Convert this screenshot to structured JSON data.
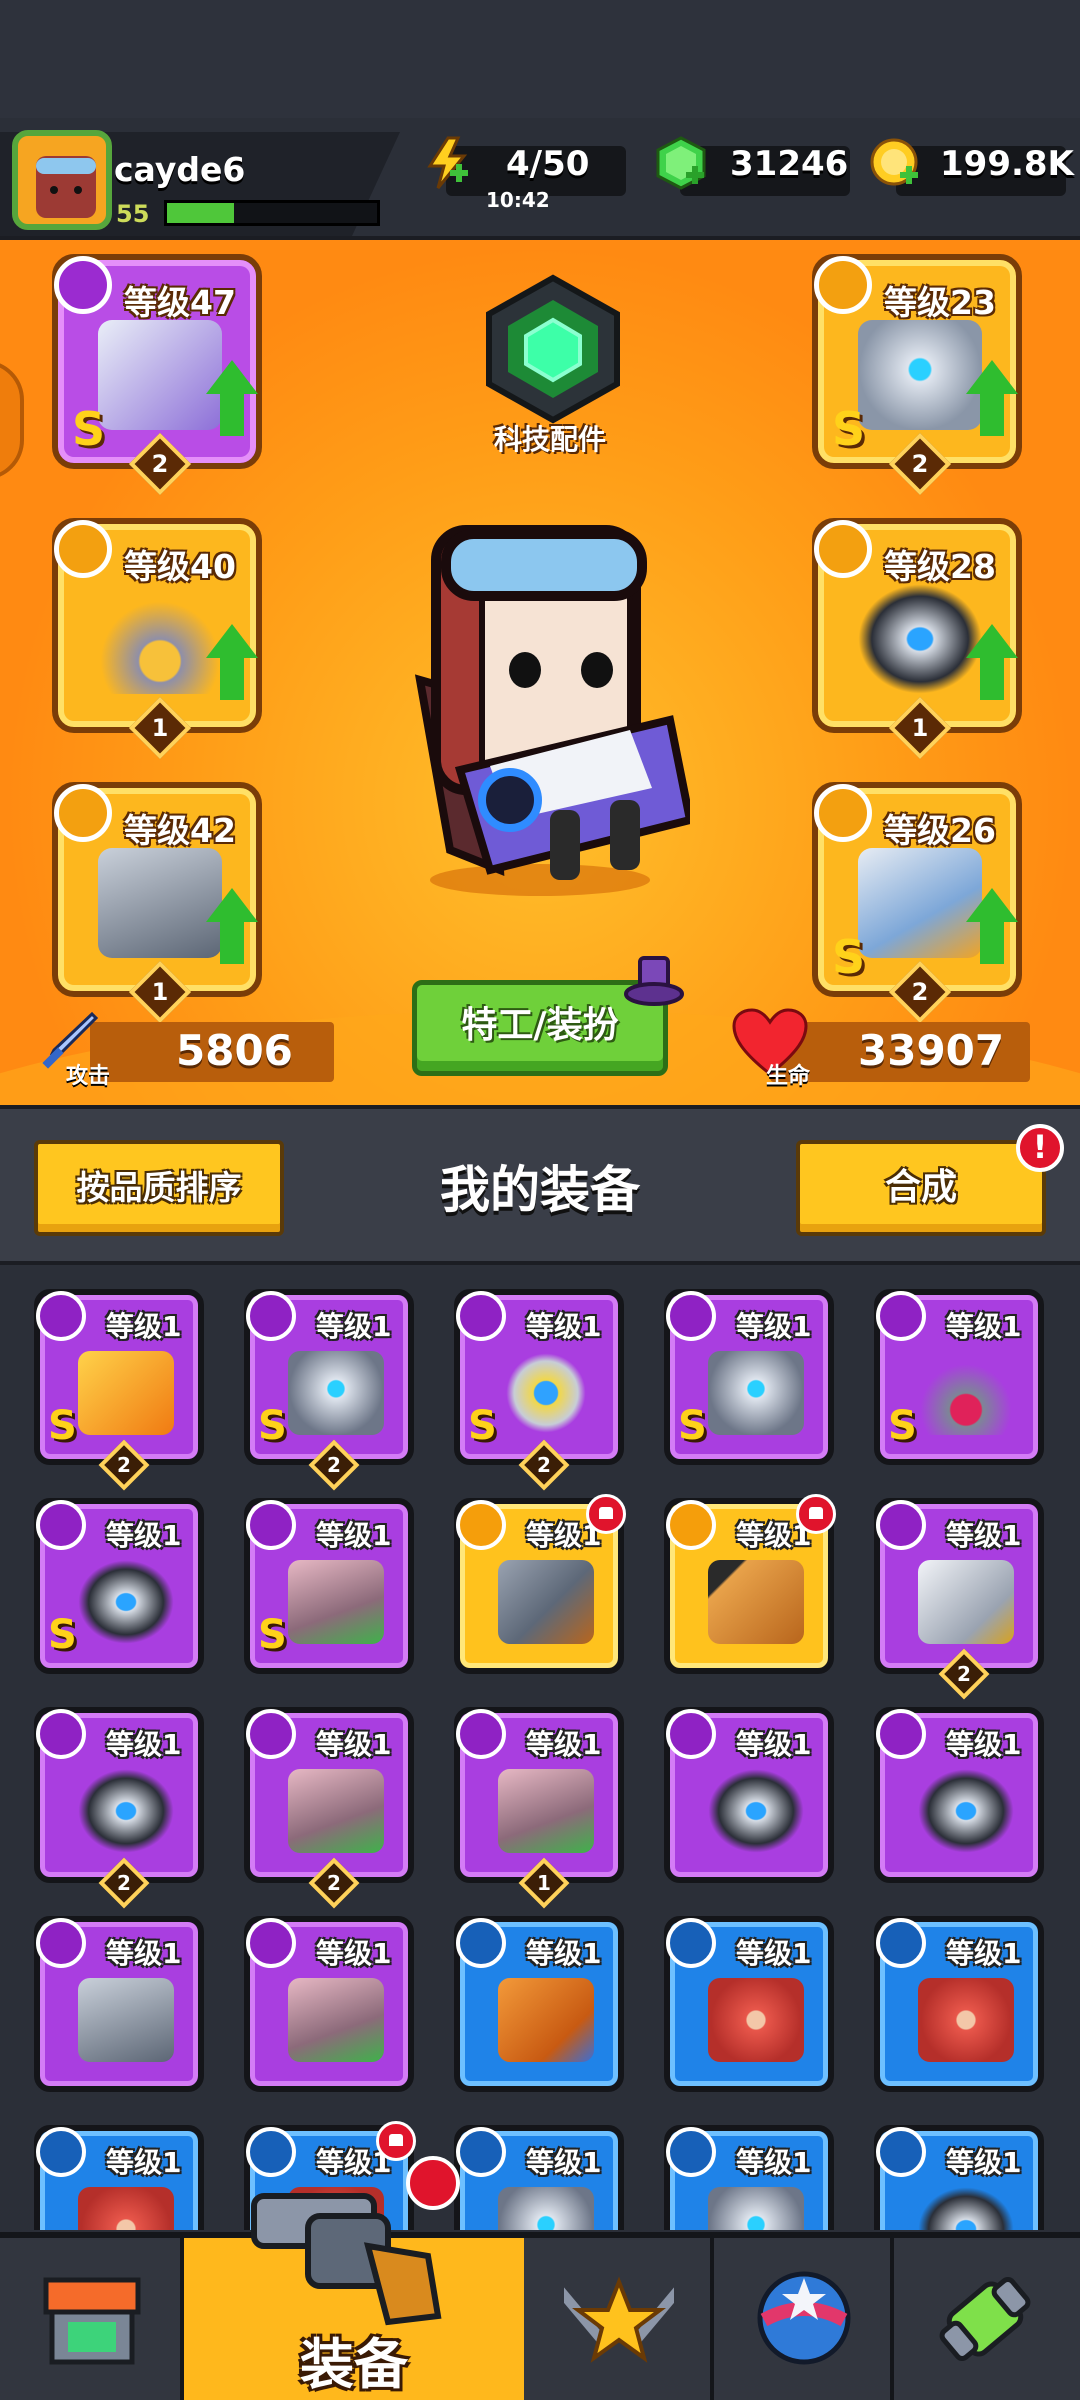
{
  "player": {
    "name": "cayde6",
    "level": "55",
    "xp_fraction": 0.32
  },
  "resources": {
    "energy": {
      "value": "4/50",
      "timer": "10:42",
      "icon": "lightning-icon"
    },
    "gems": {
      "value": "31246",
      "icon": "gem-icon"
    },
    "coins": {
      "value": "199.8K",
      "icon": "coin-icon"
    }
  },
  "slots": {
    "weapon": {
      "level": "等级47",
      "grade": "S",
      "stars": "2",
      "upgrade": true,
      "icon": "gun-icon"
    },
    "necklace": {
      "level": "等级40",
      "grade": "",
      "stars": "1",
      "upgrade": true,
      "icon": "necklace-icon"
    },
    "gloves": {
      "level": "等级42",
      "grade": "",
      "stars": "1",
      "upgrade": true,
      "icon": "glove-icon"
    },
    "armor": {
      "level": "等级23",
      "grade": "S",
      "stars": "2",
      "upgrade": true,
      "icon": "armor-icon"
    },
    "belt": {
      "level": "等级28",
      "grade": "",
      "stars": "1",
      "upgrade": true,
      "icon": "belt-icon"
    },
    "boots": {
      "level": "等级26",
      "grade": "S",
      "stars": "2",
      "upgrade": true,
      "icon": "boot-icon"
    }
  },
  "tech": {
    "label": "科技配件"
  },
  "stats": {
    "attack": {
      "label": "攻击",
      "value": "5806"
    },
    "health": {
      "label": "生命",
      "value": "33907"
    }
  },
  "agent_button": "特工/装扮",
  "inventory_header": {
    "sort": "按品质排序",
    "title": "我的装备",
    "synthesize": "合成",
    "alert": "!"
  },
  "inventory": [
    {
      "level": "等级1",
      "rarity": "purple",
      "grade": "S",
      "stars": "2",
      "icon": "sword-icon",
      "new": false
    },
    {
      "level": "等级1",
      "rarity": "purple",
      "grade": "S",
      "stars": "2",
      "icon": "armor-icon",
      "new": false
    },
    {
      "level": "等级1",
      "rarity": "purple",
      "grade": "S",
      "stars": "2",
      "icon": "ring-icon",
      "new": false
    },
    {
      "level": "等级1",
      "rarity": "purple",
      "grade": "S",
      "stars": "",
      "icon": "armor-icon",
      "new": false
    },
    {
      "level": "等级1",
      "rarity": "purple",
      "grade": "S",
      "stars": "",
      "icon": "necklace-icon",
      "new": false
    },
    {
      "level": "等级1",
      "rarity": "purple",
      "grade": "S",
      "stars": "",
      "icon": "belt-icon",
      "new": false
    },
    {
      "level": "等级1",
      "rarity": "purple",
      "grade": "S",
      "stars": "",
      "icon": "boot-icon",
      "new": false
    },
    {
      "level": "等级1",
      "rarity": "gold",
      "grade": "",
      "stars": "",
      "icon": "revolver-icon",
      "new": true
    },
    {
      "level": "等级1",
      "rarity": "gold",
      "grade": "",
      "stars": "",
      "icon": "torch-icon",
      "new": true
    },
    {
      "level": "等级1",
      "rarity": "purple",
      "grade": "",
      "stars": "2",
      "icon": "katana-icon",
      "new": false
    },
    {
      "level": "等级1",
      "rarity": "purple",
      "grade": "",
      "stars": "2",
      "icon": "belt-icon",
      "new": false
    },
    {
      "level": "等级1",
      "rarity": "purple",
      "grade": "",
      "stars": "2",
      "icon": "boot-icon",
      "new": false
    },
    {
      "level": "等级1",
      "rarity": "purple",
      "grade": "",
      "stars": "1",
      "icon": "boot-icon",
      "new": false
    },
    {
      "level": "等级1",
      "rarity": "purple",
      "grade": "",
      "stars": "",
      "icon": "belt-icon",
      "new": false
    },
    {
      "level": "等级1",
      "rarity": "purple",
      "grade": "",
      "stars": "",
      "icon": "belt-icon",
      "new": false
    },
    {
      "level": "等级1",
      "rarity": "purple",
      "grade": "",
      "stars": "",
      "icon": "glove-icon",
      "new": false
    },
    {
      "level": "等级1",
      "rarity": "purple",
      "grade": "",
      "stars": "",
      "icon": "boot-icon",
      "new": false
    },
    {
      "level": "等级1",
      "rarity": "blue",
      "grade": "",
      "stars": "",
      "icon": "bat-icon",
      "new": false
    },
    {
      "level": "等级1",
      "rarity": "blue",
      "grade": "",
      "stars": "",
      "icon": "vest-icon",
      "new": false
    },
    {
      "level": "等级1",
      "rarity": "blue",
      "grade": "",
      "stars": "",
      "icon": "vest-icon",
      "new": false
    },
    {
      "level": "等级1",
      "rarity": "blue",
      "grade": "",
      "stars": "",
      "icon": "vest-icon",
      "new": false
    },
    {
      "level": "等级1",
      "rarity": "blue",
      "grade": "",
      "stars": "",
      "icon": "vest-icon",
      "new": true
    },
    {
      "level": "等级1",
      "rarity": "blue",
      "grade": "",
      "stars": "",
      "icon": "armor-icon",
      "new": false
    },
    {
      "level": "等级1",
      "rarity": "blue",
      "grade": "",
      "stars": "",
      "icon": "armor-icon",
      "new": false
    },
    {
      "level": "等级1",
      "rarity": "blue",
      "grade": "",
      "stars": "",
      "icon": "belt-icon",
      "new": false
    }
  ],
  "nav": {
    "tabs": [
      {
        "id": "shop",
        "icon": "shop-icon"
      },
      {
        "id": "equipment",
        "label": "装备",
        "icon": "revolver-icon",
        "new": true
      },
      {
        "id": "challenge",
        "icon": "star-swords-icon"
      },
      {
        "id": "map",
        "icon": "planet-icon"
      },
      {
        "id": "dna",
        "icon": "dna-capsule-icon"
      }
    ]
  },
  "colors": {
    "purple": "#a93ee0",
    "gold": "#ffc21d",
    "blue": "#1f83e8",
    "accent_green": "#4fc73a",
    "stage_orange": "#ff9d17"
  }
}
